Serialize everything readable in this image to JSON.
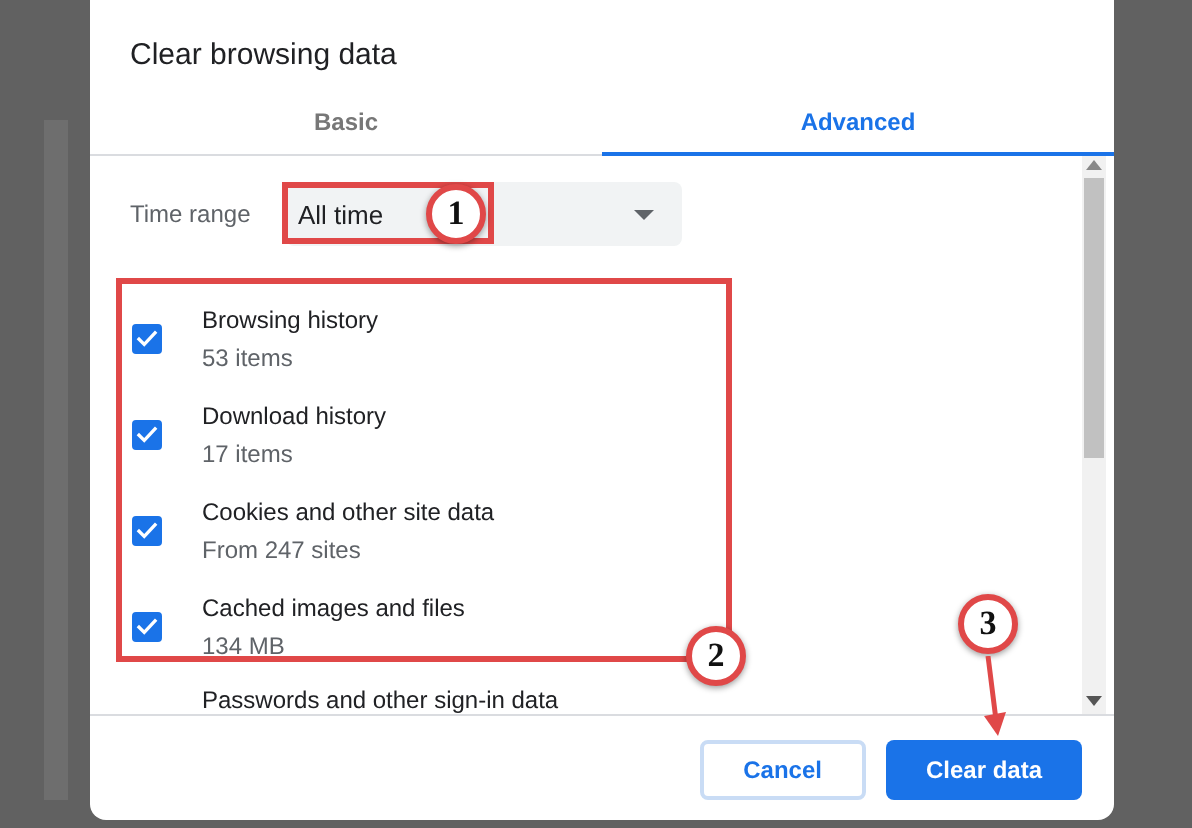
{
  "dialog": {
    "title": "Clear browsing data"
  },
  "tabs": [
    {
      "label": "Basic",
      "selected": false
    },
    {
      "label": "Advanced",
      "selected": true
    }
  ],
  "time_range": {
    "label": "Time range",
    "value": "All time"
  },
  "items": [
    {
      "title": "Browsing history",
      "detail": "53 items",
      "checked": true
    },
    {
      "title": "Download history",
      "detail": "17 items",
      "checked": true
    },
    {
      "title": "Cookies and other site data",
      "detail": "From 247 sites",
      "checked": true
    },
    {
      "title": "Cached images and files",
      "detail": "134 MB",
      "checked": true
    }
  ],
  "cut_item": {
    "title": "Passwords and other sign-in data"
  },
  "buttons": [
    {
      "label": "Cancel",
      "kind": "secondary"
    },
    {
      "label": "Clear data",
      "kind": "primary"
    }
  ],
  "annotations": [
    {
      "number": "1",
      "kind": "box"
    },
    {
      "number": "2",
      "kind": "box"
    },
    {
      "number": "3",
      "kind": "arrow"
    }
  ]
}
